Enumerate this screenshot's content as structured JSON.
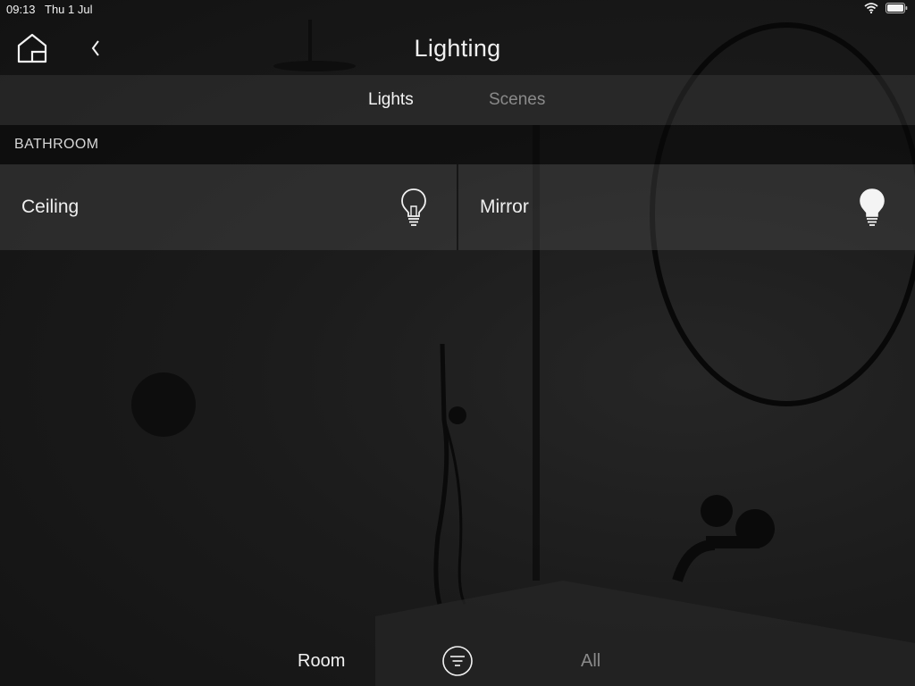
{
  "status_bar": {
    "time": "09:13",
    "date": "Thu 1 Jul",
    "wifi_icon": "wifi-icon",
    "battery_icon": "battery-icon"
  },
  "header": {
    "title": "Lighting",
    "home_icon": "home-icon",
    "back_icon": "chevron-left-icon"
  },
  "tabs": [
    {
      "label": "Lights",
      "active": true
    },
    {
      "label": "Scenes",
      "active": false
    }
  ],
  "section": {
    "label": "BATHROOM"
  },
  "lights": [
    {
      "name": "Ceiling",
      "state": "off",
      "icon": "lightbulb-outline-icon"
    },
    {
      "name": "Mirror",
      "state": "on",
      "icon": "lightbulb-filled-icon"
    }
  ],
  "bottom_bar": {
    "room_label": "Room",
    "filter_icon": "filter-icon",
    "all_label": "All"
  },
  "colors": {
    "active_text": "#f5f5f5",
    "inactive_text": "#8a8a8a",
    "tile_background": "#4b4b4b"
  }
}
